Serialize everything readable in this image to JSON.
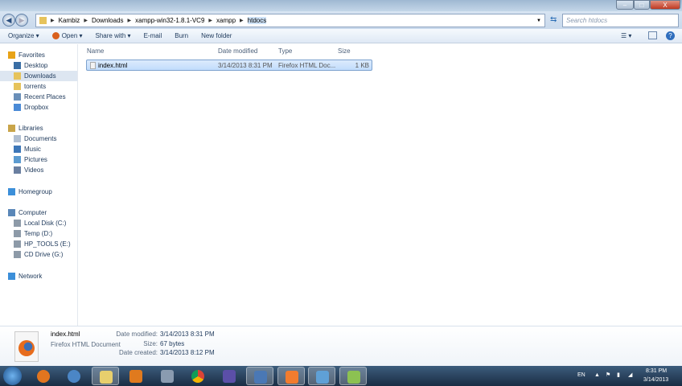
{
  "window": {
    "minimize": "–",
    "maximize": "□",
    "close": "X"
  },
  "address": {
    "crumbs": [
      "Kambiz",
      "Downloads",
      "xampp-win32-1.8.1-VC9",
      "xampp",
      "htdocs"
    ],
    "search_placeholder": "Search htdocs"
  },
  "toolbar": {
    "organize": "Organize ▾",
    "open": "Open ▾",
    "share": "Share with ▾",
    "email": "E-mail",
    "burn": "Burn",
    "new_folder": "New folder"
  },
  "sidebar": {
    "items": [
      {
        "label": "Favorites",
        "icon": "star-icon",
        "color": "#e8a317"
      },
      {
        "label": "Desktop",
        "icon": "desktop-icon",
        "color": "#3a6ea5"
      },
      {
        "label": "Downloads",
        "icon": "folder-icon",
        "color": "#e6c35c"
      },
      {
        "label": "torrents",
        "icon": "folder-icon",
        "color": "#e6c35c"
      },
      {
        "label": "Recent Places",
        "icon": "recent-places-icon",
        "color": "#6a8fb8"
      },
      {
        "label": "Dropbox",
        "icon": "dropbox-icon",
        "color": "#4a8ad6"
      },
      {
        "label": "Libraries",
        "icon": "libraries-icon",
        "color": "#c9a54a"
      },
      {
        "label": "Documents",
        "icon": "documents-icon",
        "color": "#b0bfd2"
      },
      {
        "label": "Music",
        "icon": "music-icon",
        "color": "#3d77b8"
      },
      {
        "label": "Pictures",
        "icon": "pictures-icon",
        "color": "#5c9bd0"
      },
      {
        "label": "Videos",
        "icon": "videos-icon",
        "color": "#6a7fa0"
      },
      {
        "label": "Homegroup",
        "icon": "homegroup-icon",
        "color": "#3c8fd9"
      },
      {
        "label": "Computer",
        "icon": "computer-icon",
        "color": "#5a87b8"
      },
      {
        "label": "Local Disk (C:)",
        "icon": "drive-icon",
        "color": "#8d9aa8"
      },
      {
        "label": "Temp (D:)",
        "icon": "drive-icon",
        "color": "#8d9aa8"
      },
      {
        "label": "HP_TOOLS (E:)",
        "icon": "drive-icon",
        "color": "#8d9aa8"
      },
      {
        "label": "CD Drive (G:)",
        "icon": "cd-drive-icon",
        "color": "#8d9aa8"
      },
      {
        "label": "Network",
        "icon": "network-icon",
        "color": "#3c8fd9"
      }
    ]
  },
  "columns": {
    "name": "Name",
    "date": "Date modified",
    "type": "Type",
    "size": "Size"
  },
  "files": [
    {
      "name": "index.html",
      "date": "3/14/2013 8:31 PM",
      "type": "Firefox HTML Doc...",
      "size": "1 KB"
    }
  ],
  "details": {
    "name": "index.html",
    "type": "Firefox HTML Document",
    "modified_label": "Date modified:",
    "modified": "3/14/2013 8:31 PM",
    "size_label": "Size:",
    "size": "67 bytes",
    "created_label": "Date created:",
    "created": "3/14/2013 8:12 PM"
  },
  "taskbar": {
    "lang": "EN",
    "time": "8:31 PM",
    "date": "3/14/2013"
  }
}
